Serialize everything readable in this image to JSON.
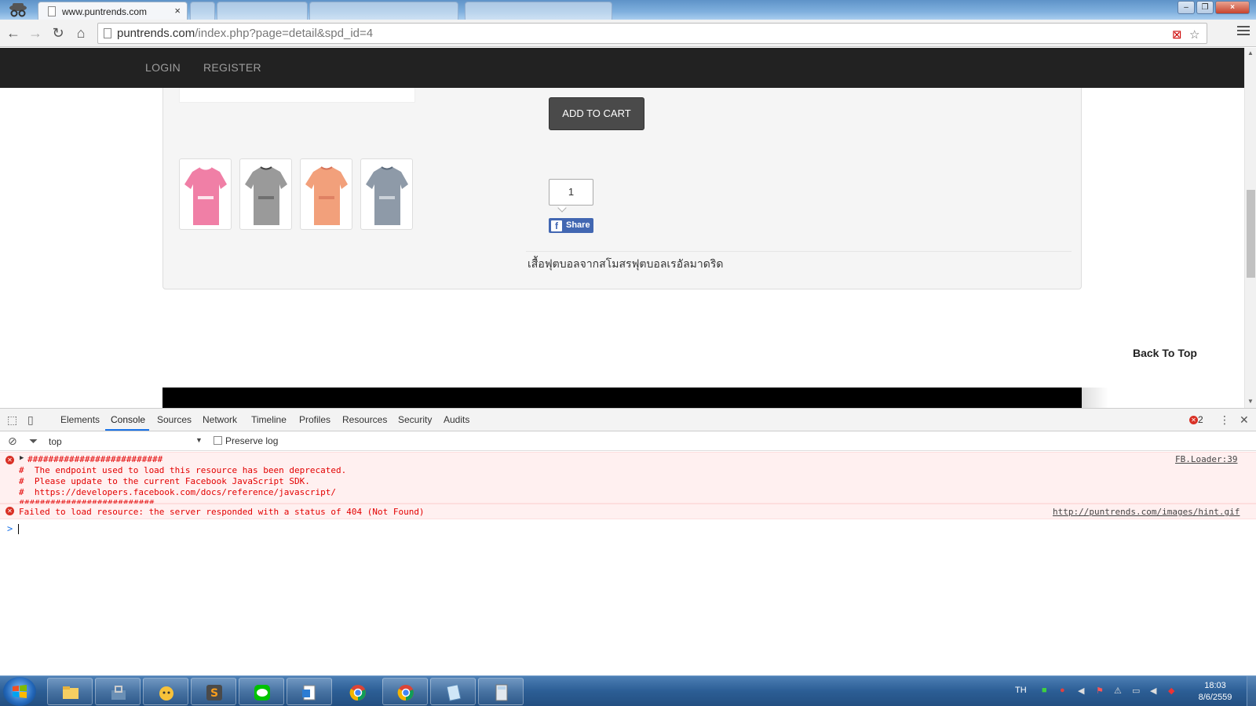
{
  "browser": {
    "active_tab": {
      "title": "www.puntrends.com",
      "close_glyph": "×"
    },
    "window_controls": {
      "minimize": "–",
      "maximize": "❐",
      "close": "×"
    },
    "url": {
      "domain": "puntrends.com",
      "path": "/index.php?page=detail&spd_id=4"
    },
    "icons": {
      "back": "back-arrow-icon",
      "forward": "forward-arrow-icon",
      "reload": "reload-icon",
      "home": "home-icon",
      "star": "star-icon",
      "menu": "hamburger-menu-icon"
    }
  },
  "site": {
    "nav": {
      "login": "LOGIN",
      "register": "REGISTER"
    },
    "product": {
      "add_to_cart": "ADD TO CART",
      "quantity": "1",
      "share": "Share",
      "description": "เสื้อฟุตบอลจากสโมสรฟุตบอลเรอัลมาดริด",
      "thumbnails": [
        "pink-jersey",
        "grey-jersey",
        "orange-jersey",
        "blue-grey-jersey"
      ]
    },
    "back_to_top": "Back To Top"
  },
  "devtools": {
    "tabs": [
      "Elements",
      "Console",
      "Sources",
      "Network",
      "Timeline",
      "Profiles",
      "Resources",
      "Security",
      "Audits"
    ],
    "active_tab": "Console",
    "error_count": "2",
    "context": "top",
    "preserve_log": "Preserve log",
    "messages": [
      {
        "lines": [
          "##########################",
          "#  The endpoint used to load this resource has been deprecated.",
          "#  Please update to the current Facebook JavaScript SDK.",
          "#  https://developers.facebook.com/docs/reference/javascript/",
          "##########################"
        ],
        "source": "FB.Loader:39"
      },
      {
        "lines": [
          "Failed to load resource: the server responded with a status of 404 (Not Found)"
        ],
        "source": "http://puntrends.com/images/hint.gif"
      }
    ],
    "prompt": ">"
  },
  "taskbar": {
    "language": "TH",
    "time": "18:03",
    "date": "8/6/2559"
  },
  "colors": {
    "nav_bg": "#222222",
    "button_dark": "#4a4a4a",
    "facebook_blue": "#4267b2",
    "error_red": "#e30000",
    "error_bg": "#fff0f0",
    "devtools_accent": "#1a73e8"
  }
}
